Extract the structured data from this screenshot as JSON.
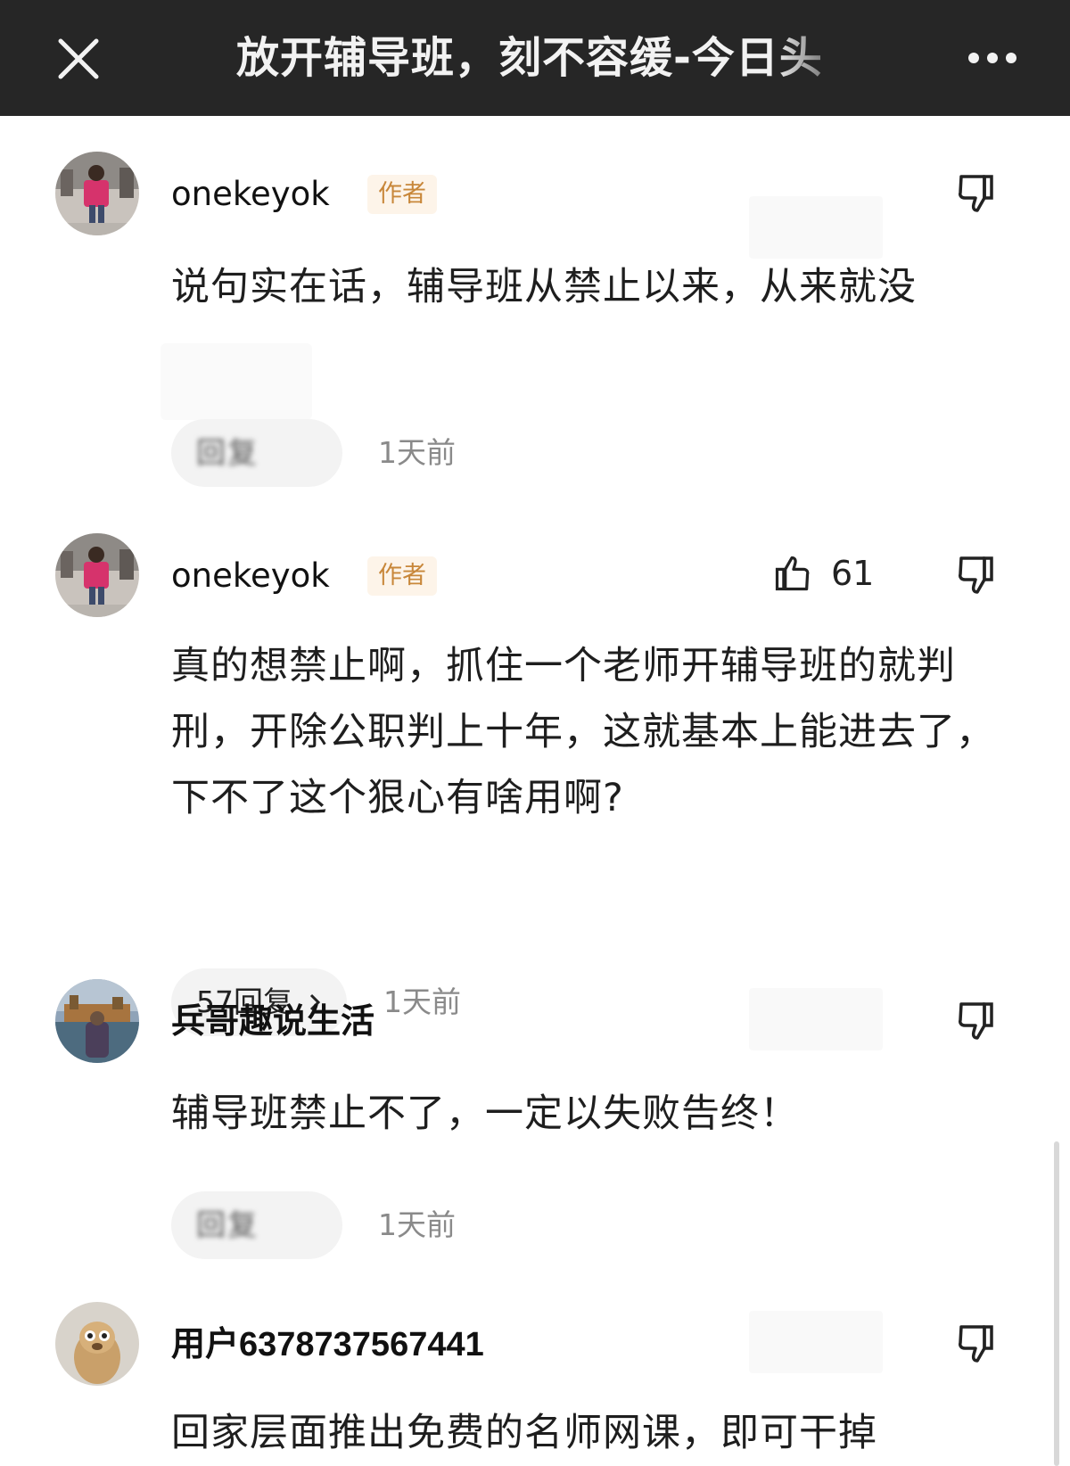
{
  "header": {
    "title": "放开辅导班，刻不容缓-今日头",
    "close_icon": "close-icon",
    "more_icon": "more-icon"
  },
  "comments": [
    {
      "username": "onekeyok",
      "badge": "作者",
      "text": "说句实在话，辅导班从禁止以来，从来就没",
      "reply_label": "回复",
      "time": "1天前",
      "likes": null
    },
    {
      "username": "onekeyok",
      "badge": "作者",
      "text": "真的想禁止啊，抓住一个老师开辅导班的就判刑，开除公职判上十年，这就基本上能进去了，下不了这个狠心有啥用啊?",
      "reply_label": "57回复",
      "time": "1天前",
      "likes": "61"
    },
    {
      "username": "兵哥趣说生活",
      "badge": "",
      "text": "辅导班禁止不了，一定以失败告终！",
      "reply_label": "回复",
      "time": "1天前",
      "likes": null
    },
    {
      "username": "用户6378737567441",
      "badge": "",
      "text": "回家层面推出免费的名师网课，即可干掉",
      "reply_label": "",
      "time": "",
      "likes": null
    }
  ],
  "icons": {
    "like": "thumbs-up-icon",
    "dislike": "thumbs-down-icon",
    "chevron": "chevron-right-icon"
  },
  "colors": {
    "header_bg": "#262626",
    "badge_bg": "#fdf4e9",
    "badge_text": "#c8873a",
    "pill_bg": "#f3f3f3",
    "time_text": "#8a8a8a"
  }
}
